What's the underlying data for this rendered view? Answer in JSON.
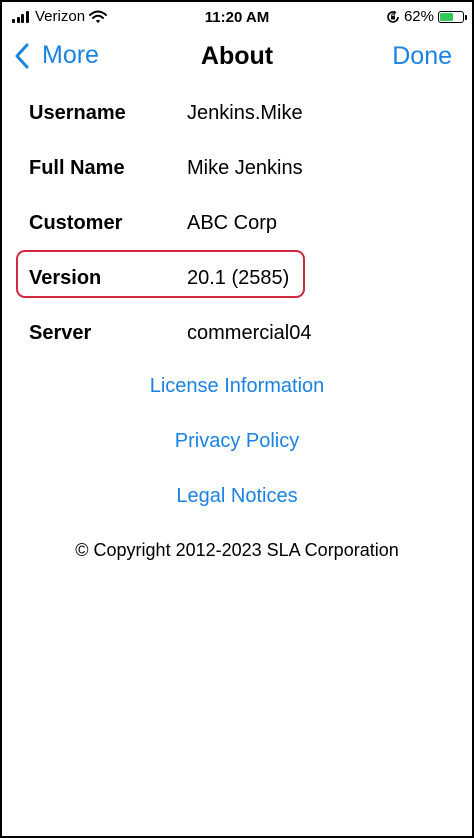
{
  "status_bar": {
    "carrier": "Verizon",
    "time": "11:20 AM",
    "battery_percent": "62%",
    "battery_level": 0.62,
    "icons": [
      "signal-icon",
      "wifi-icon",
      "orientation-lock-icon",
      "battery-icon"
    ]
  },
  "nav": {
    "back_label": "More",
    "title": "About",
    "done_label": "Done"
  },
  "info": {
    "rows": [
      {
        "label": "Username",
        "value": "Jenkins.Mike"
      },
      {
        "label": "Full Name",
        "value": "Mike Jenkins"
      },
      {
        "label": "Customer",
        "value": "ABC Corp"
      },
      {
        "label": "Version",
        "value": "20.1 (2585)"
      },
      {
        "label": "Server",
        "value": "commercial04"
      }
    ]
  },
  "links": {
    "license": "License Information",
    "privacy": "Privacy Policy",
    "legal": "Legal Notices"
  },
  "copyright": "© Copyright 2012-2023 SLA Corporation",
  "colors": {
    "accent": "#1a82e2",
    "highlight": "#d0273b",
    "battery": "#34c759"
  }
}
